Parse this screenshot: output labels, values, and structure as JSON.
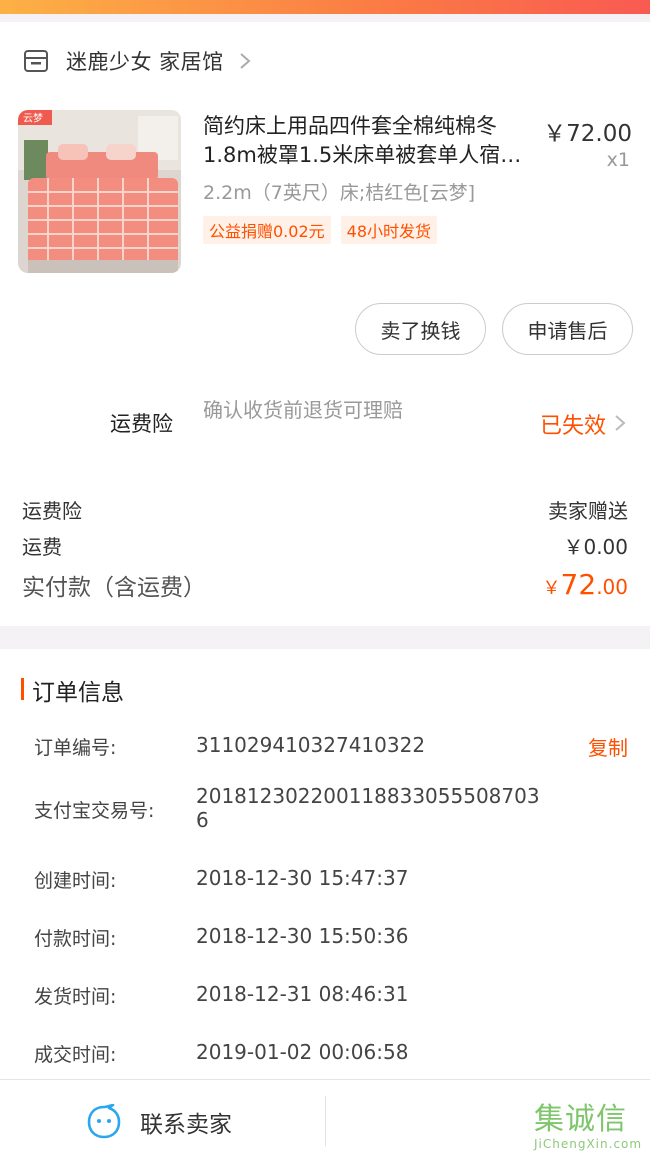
{
  "shop": {
    "name": "迷鹿少女 家居馆"
  },
  "product": {
    "thumb_badge": "云梦",
    "title": "简约床上用品四件套全棉纯棉冬1.8m被罩1.5米床单被套单人宿舍三件套",
    "price": "￥72.00",
    "quantity": "x1",
    "sku": "2.2m（7英尺）床;桔红色[云梦]",
    "tags": [
      "公益捐赠0.02元",
      "48小时发货"
    ]
  },
  "actions": {
    "sell": "卖了换钱",
    "after_sale": "申请售后"
  },
  "insurance": {
    "label": "运费险",
    "desc": "确认收货前退货可理赔",
    "status": "已失效"
  },
  "fees": [
    {
      "label": "运费险",
      "value": "卖家赠送"
    },
    {
      "label": "运费",
      "value": "￥0.00"
    }
  ],
  "total": {
    "label": "实付款（含运费）",
    "currency": "￥",
    "integer": "72",
    "decimal": ".00"
  },
  "order_info": {
    "title": "订单信息",
    "copy": "复制",
    "rows": [
      {
        "label": "订单编号:",
        "value": "311029410327410322"
      },
      {
        "label": "支付宝交易号:",
        "value": "2018123022001188330555087036"
      },
      {
        "label": "创建时间:",
        "value": "2018-12-30 15:47:37"
      },
      {
        "label": "付款时间:",
        "value": "2018-12-30 15:50:36"
      },
      {
        "label": "发货时间:",
        "value": "2018-12-31 08:46:31"
      },
      {
        "label": "成交时间:",
        "value": "2019-01-02 00:06:58"
      }
    ]
  },
  "bottom": {
    "contact": "联系卖家"
  },
  "watermark": {
    "cn": "集诚信",
    "en": "JiChengXin.com"
  },
  "colors": {
    "accent": "#ff5000",
    "tag_bg": "#fff1e8",
    "watermark": "#7ec66b"
  }
}
